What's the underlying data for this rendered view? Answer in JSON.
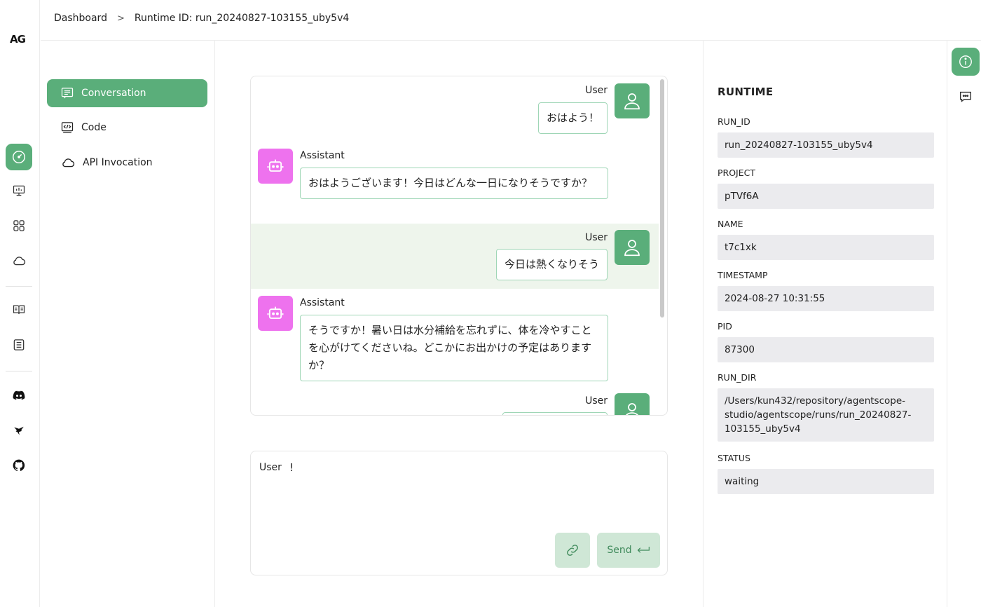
{
  "logo": "AG",
  "breadcrumb": {
    "root": "Dashboard",
    "separator": ">",
    "current": "Runtime ID: run_20240827-103155_uby5v4"
  },
  "subnav": [
    {
      "label": "Conversation",
      "icon": "chat-lines-icon",
      "active": true
    },
    {
      "label": "Code",
      "icon": "code-icon",
      "active": false
    },
    {
      "label": "API Invocation",
      "icon": "cloud-icon",
      "active": false
    }
  ],
  "messages": [
    {
      "role": "User",
      "text": "おはよう！"
    },
    {
      "role": "Assistant",
      "text": "おはようございます！今日はどんな一日になりそうですか？"
    },
    {
      "role": "User",
      "text": "今日は熱くなりそう"
    },
    {
      "role": "Assistant",
      "text": "そうですか！暑い日は水分補給を忘れずに、体を冷やすことを心がけてくださいね。どこかにお出かけの予定はありますか？"
    },
    {
      "role": "User",
      "text": ""
    }
  ],
  "composer": {
    "prefix": "User",
    "caret": "!",
    "send_label": "Send",
    "send_icon": "enter-arrow-icon"
  },
  "runtime": {
    "title": "RUNTIME",
    "fields": [
      {
        "label": "RUN_ID",
        "value": "run_20240827-103155_uby5v4"
      },
      {
        "label": "PROJECT",
        "value": "pTVf6A"
      },
      {
        "label": "NAME",
        "value": "t7c1xk"
      },
      {
        "label": "TIMESTAMP",
        "value": "2024-08-27 10:31:55"
      },
      {
        "label": "PID",
        "value": "87300"
      },
      {
        "label": "RUN_DIR",
        "value": "/Users/kun432/repository/agentscope-studio/agentscope/runs/run_20240827-103155_uby5v4"
      },
      {
        "label": "STATUS",
        "value": "waiting"
      }
    ]
  },
  "colors": {
    "accent": "#5aae7a",
    "assistant_avatar": "#ee72ee",
    "highlight_row": "#eef5ec",
    "bubble_border": "#9fd6b6"
  }
}
